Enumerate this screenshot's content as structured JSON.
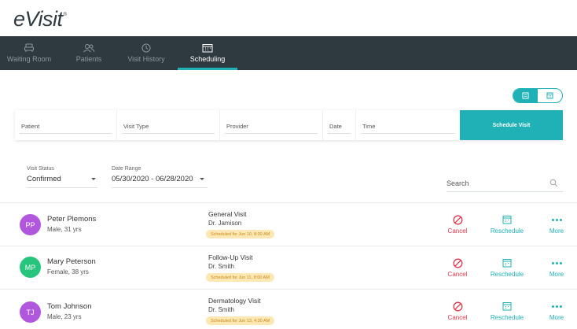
{
  "app": {
    "logo": "eVisit",
    "logo_mark": "®"
  },
  "colors": {
    "accent": "#1fb1b5",
    "nav_bg": "#2f3a40",
    "cancel": "#e0354b",
    "badge_bg": "#fde7b3",
    "badge_text": "#c8891b"
  },
  "nav": {
    "tabs": [
      {
        "label": "Waiting Room",
        "icon": "waiting-room-icon"
      },
      {
        "label": "Patients",
        "icon": "patients-icon"
      },
      {
        "label": "Visit History",
        "icon": "clock-icon"
      },
      {
        "label": "Scheduling",
        "icon": "calendar-icon",
        "active": true
      }
    ]
  },
  "form": {
    "patient": "Patient",
    "visit_type": "Visit Type",
    "provider": "Provider",
    "date": "Date",
    "time": "Time",
    "schedule_button": "Schedule Visit"
  },
  "filters": {
    "visit_status_label": "Visit Status",
    "visit_status_value": "Confirmed",
    "date_range_label": "Date Range",
    "date_range_value": "05/30/2020 - 06/28/2020"
  },
  "search": {
    "placeholder": "Search"
  },
  "actions": {
    "cancel": "Cancel",
    "reschedule": "Reschedule",
    "more": "More"
  },
  "visits": [
    {
      "initials": "PP",
      "name": "Peter Plemons",
      "meta": "Male, 31 yrs",
      "avatar_color": "#b157dd",
      "visit_type": "General Visit",
      "doctor": "Dr. Jamison",
      "scheduled": "Scheduled for Jun 10, 8:00 AM"
    },
    {
      "initials": "MP",
      "name": "Mary Peterson",
      "meta": "Female, 38 yrs",
      "avatar_color": "#27c47e",
      "visit_type": "Follow-Up Visit",
      "doctor": "Dr. Smith",
      "scheduled": "Scheduled for Jun 11, 8:00 AM"
    },
    {
      "initials": "TJ",
      "name": "Tom Johnson",
      "meta": "Male, 23 yrs",
      "avatar_color": "#b157dd",
      "visit_type": "Dermatology Visit",
      "doctor": "Dr. Smith",
      "scheduled": "Scheduled for Jun 13, 4:30 AM"
    }
  ]
}
